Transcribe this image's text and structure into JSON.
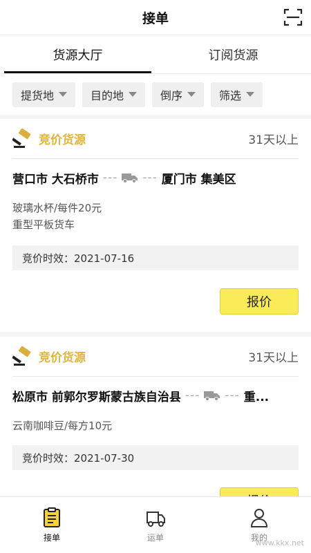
{
  "header": {
    "title": "接单"
  },
  "tabs": [
    {
      "label": "货源大厅",
      "active": true
    },
    {
      "label": "订阅货源",
      "active": false
    }
  ],
  "filters": [
    {
      "label": "提货地"
    },
    {
      "label": "目的地"
    },
    {
      "label": "倒序"
    },
    {
      "label": "筛选"
    }
  ],
  "cards": [
    {
      "type_label": "竞价货源",
      "age": "31天以上",
      "origin": "营口市 大石桥市",
      "dest": "厦门市 集美区",
      "dashes": "---",
      "goods": "玻璃水杯/每件20元",
      "vehicle": "重型平板货车",
      "deadline": "竞价时效：2021-07-16",
      "button": "报价"
    },
    {
      "type_label": "竞价货源",
      "age": "31天以上",
      "origin": "松原市 前郭尔罗斯蒙古族自治县",
      "dest": "重...",
      "dashes": "---",
      "goods": "云南咖啡豆/每方10元",
      "deadline": "竞价时效：2021-07-30",
      "button": "报价"
    }
  ],
  "tabbar": [
    {
      "label": "接单",
      "icon": "clipboard-icon",
      "active": true
    },
    {
      "label": "运单",
      "icon": "truck-icon",
      "active": false
    },
    {
      "label": "我的",
      "icon": "user-icon",
      "active": false
    }
  ],
  "watermark": "www.kkx.net",
  "colors": {
    "accent": "#e1b43a",
    "button": "#f9ec58"
  }
}
